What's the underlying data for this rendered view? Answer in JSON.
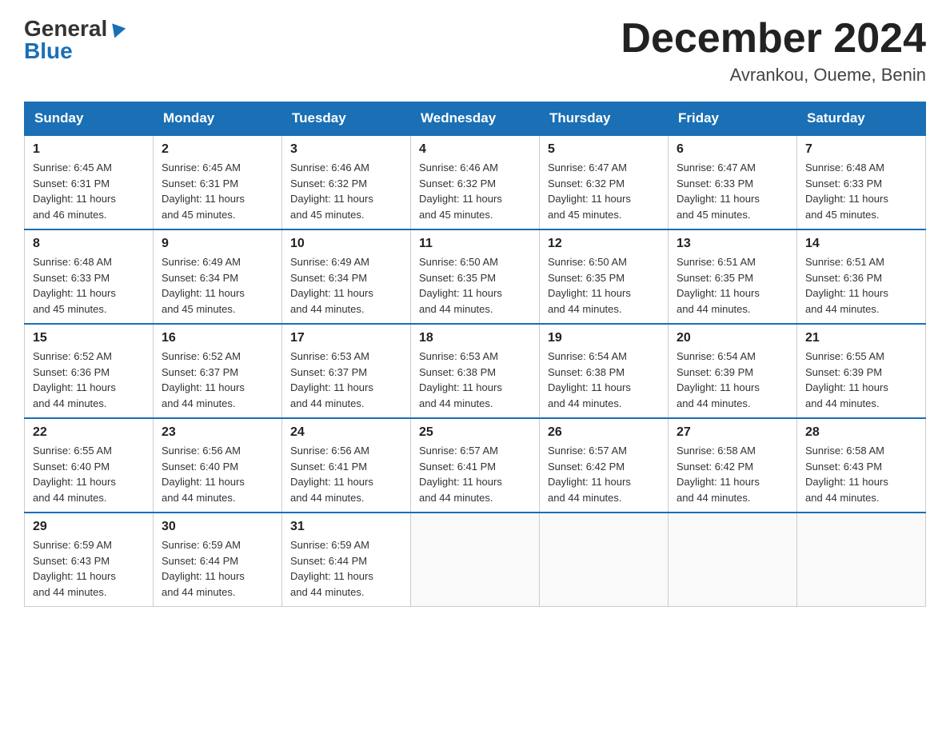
{
  "logo": {
    "general": "General",
    "blue": "Blue"
  },
  "title": {
    "month": "December 2024",
    "location": "Avrankou, Oueme, Benin"
  },
  "days_header": [
    "Sunday",
    "Monday",
    "Tuesday",
    "Wednesday",
    "Thursday",
    "Friday",
    "Saturday"
  ],
  "weeks": [
    [
      {
        "day": "1",
        "sunrise": "6:45 AM",
        "sunset": "6:31 PM",
        "daylight": "11 hours and 46 minutes."
      },
      {
        "day": "2",
        "sunrise": "6:45 AM",
        "sunset": "6:31 PM",
        "daylight": "11 hours and 45 minutes."
      },
      {
        "day": "3",
        "sunrise": "6:46 AM",
        "sunset": "6:32 PM",
        "daylight": "11 hours and 45 minutes."
      },
      {
        "day": "4",
        "sunrise": "6:46 AM",
        "sunset": "6:32 PM",
        "daylight": "11 hours and 45 minutes."
      },
      {
        "day": "5",
        "sunrise": "6:47 AM",
        "sunset": "6:32 PM",
        "daylight": "11 hours and 45 minutes."
      },
      {
        "day": "6",
        "sunrise": "6:47 AM",
        "sunset": "6:33 PM",
        "daylight": "11 hours and 45 minutes."
      },
      {
        "day": "7",
        "sunrise": "6:48 AM",
        "sunset": "6:33 PM",
        "daylight": "11 hours and 45 minutes."
      }
    ],
    [
      {
        "day": "8",
        "sunrise": "6:48 AM",
        "sunset": "6:33 PM",
        "daylight": "11 hours and 45 minutes."
      },
      {
        "day": "9",
        "sunrise": "6:49 AM",
        "sunset": "6:34 PM",
        "daylight": "11 hours and 45 minutes."
      },
      {
        "day": "10",
        "sunrise": "6:49 AM",
        "sunset": "6:34 PM",
        "daylight": "11 hours and 44 minutes."
      },
      {
        "day": "11",
        "sunrise": "6:50 AM",
        "sunset": "6:35 PM",
        "daylight": "11 hours and 44 minutes."
      },
      {
        "day": "12",
        "sunrise": "6:50 AM",
        "sunset": "6:35 PM",
        "daylight": "11 hours and 44 minutes."
      },
      {
        "day": "13",
        "sunrise": "6:51 AM",
        "sunset": "6:35 PM",
        "daylight": "11 hours and 44 minutes."
      },
      {
        "day": "14",
        "sunrise": "6:51 AM",
        "sunset": "6:36 PM",
        "daylight": "11 hours and 44 minutes."
      }
    ],
    [
      {
        "day": "15",
        "sunrise": "6:52 AM",
        "sunset": "6:36 PM",
        "daylight": "11 hours and 44 minutes."
      },
      {
        "day": "16",
        "sunrise": "6:52 AM",
        "sunset": "6:37 PM",
        "daylight": "11 hours and 44 minutes."
      },
      {
        "day": "17",
        "sunrise": "6:53 AM",
        "sunset": "6:37 PM",
        "daylight": "11 hours and 44 minutes."
      },
      {
        "day": "18",
        "sunrise": "6:53 AM",
        "sunset": "6:38 PM",
        "daylight": "11 hours and 44 minutes."
      },
      {
        "day": "19",
        "sunrise": "6:54 AM",
        "sunset": "6:38 PM",
        "daylight": "11 hours and 44 minutes."
      },
      {
        "day": "20",
        "sunrise": "6:54 AM",
        "sunset": "6:39 PM",
        "daylight": "11 hours and 44 minutes."
      },
      {
        "day": "21",
        "sunrise": "6:55 AM",
        "sunset": "6:39 PM",
        "daylight": "11 hours and 44 minutes."
      }
    ],
    [
      {
        "day": "22",
        "sunrise": "6:55 AM",
        "sunset": "6:40 PM",
        "daylight": "11 hours and 44 minutes."
      },
      {
        "day": "23",
        "sunrise": "6:56 AM",
        "sunset": "6:40 PM",
        "daylight": "11 hours and 44 minutes."
      },
      {
        "day": "24",
        "sunrise": "6:56 AM",
        "sunset": "6:41 PM",
        "daylight": "11 hours and 44 minutes."
      },
      {
        "day": "25",
        "sunrise": "6:57 AM",
        "sunset": "6:41 PM",
        "daylight": "11 hours and 44 minutes."
      },
      {
        "day": "26",
        "sunrise": "6:57 AM",
        "sunset": "6:42 PM",
        "daylight": "11 hours and 44 minutes."
      },
      {
        "day": "27",
        "sunrise": "6:58 AM",
        "sunset": "6:42 PM",
        "daylight": "11 hours and 44 minutes."
      },
      {
        "day": "28",
        "sunrise": "6:58 AM",
        "sunset": "6:43 PM",
        "daylight": "11 hours and 44 minutes."
      }
    ],
    [
      {
        "day": "29",
        "sunrise": "6:59 AM",
        "sunset": "6:43 PM",
        "daylight": "11 hours and 44 minutes."
      },
      {
        "day": "30",
        "sunrise": "6:59 AM",
        "sunset": "6:44 PM",
        "daylight": "11 hours and 44 minutes."
      },
      {
        "day": "31",
        "sunrise": "6:59 AM",
        "sunset": "6:44 PM",
        "daylight": "11 hours and 44 minutes."
      },
      null,
      null,
      null,
      null
    ]
  ],
  "labels": {
    "sunrise": "Sunrise:",
    "sunset": "Sunset:",
    "daylight": "Daylight:"
  }
}
